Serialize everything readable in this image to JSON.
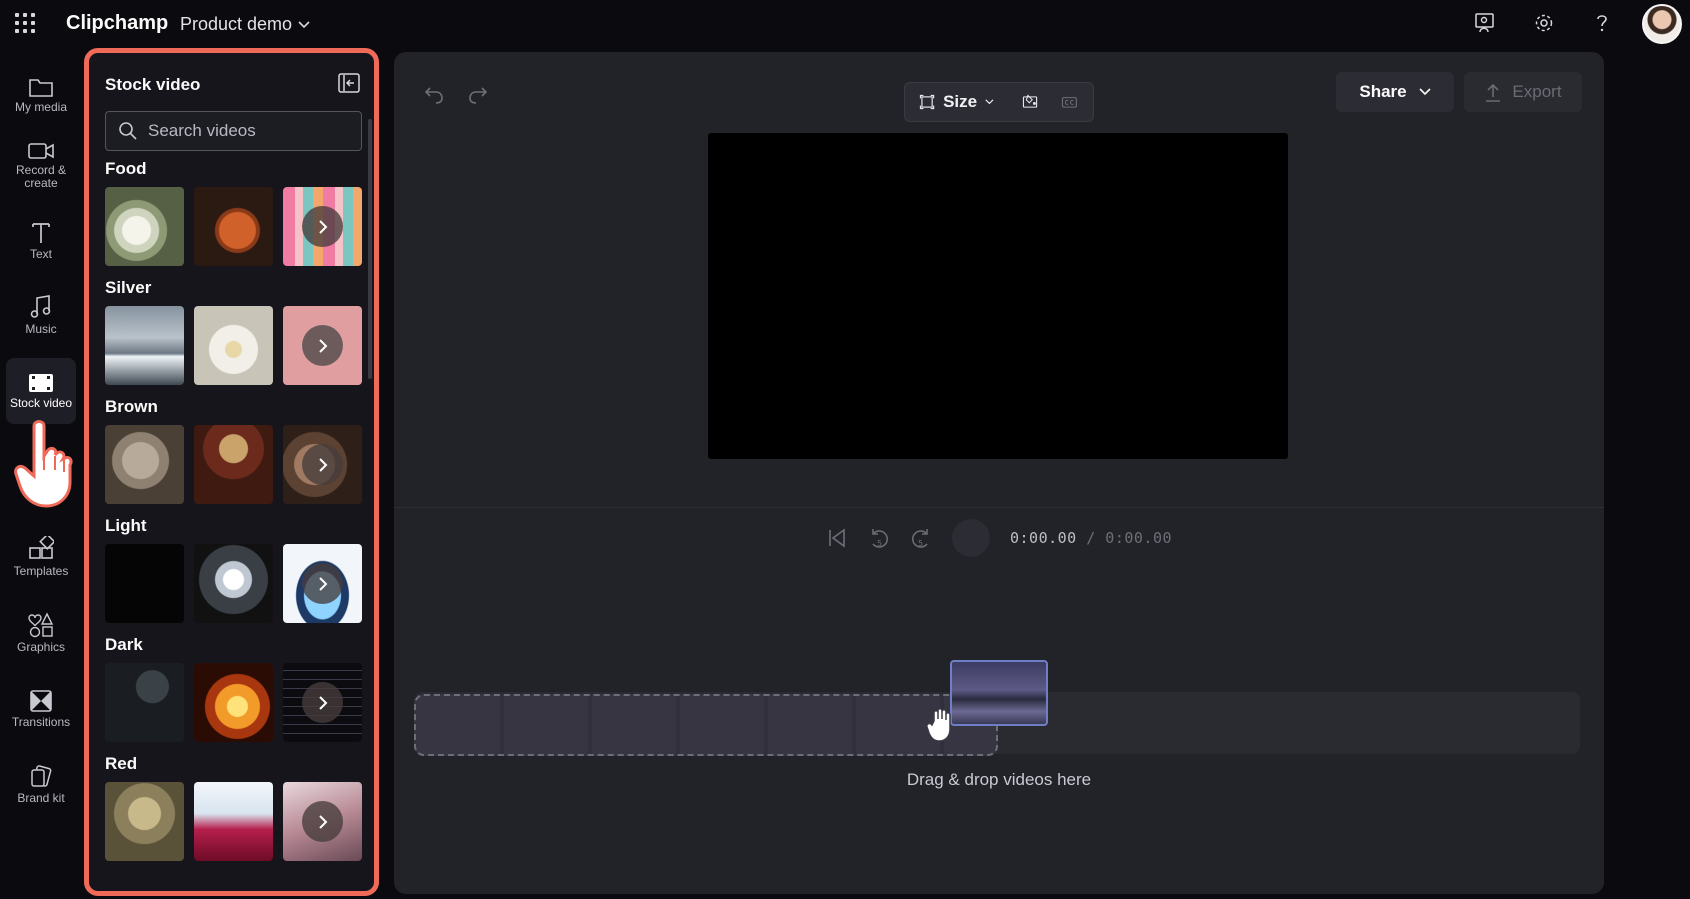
{
  "app": {
    "name": "Clipchamp",
    "project_name": "Product demo"
  },
  "rail": [
    {
      "label": "My media",
      "icon": "folder-icon"
    },
    {
      "label": "Record & create",
      "icon": "camera-icon"
    },
    {
      "label": "Text",
      "icon": "text-icon"
    },
    {
      "label": "Music",
      "icon": "music-note-icon"
    },
    {
      "label": "Stock video",
      "icon": "film-icon",
      "active": true
    },
    {
      "label": "Templates",
      "icon": "templates-icon"
    },
    {
      "label": "Graphics",
      "icon": "shapes-icon"
    },
    {
      "label": "Transitions",
      "icon": "transition-icon"
    },
    {
      "label": "Brand kit",
      "icon": "brand-kit-icon"
    }
  ],
  "panel": {
    "title": "Stock video",
    "search_placeholder": "Search videos",
    "categories": [
      {
        "title": "Food"
      },
      {
        "title": "Silver"
      },
      {
        "title": "Brown"
      },
      {
        "title": "Light"
      },
      {
        "title": "Dark"
      },
      {
        "title": "Red"
      }
    ]
  },
  "toolbar": {
    "size_label": "Size",
    "share_label": "Share",
    "export_label": "Export"
  },
  "playback": {
    "current_time": "0:00.00",
    "total_time": "/ 0:00.00"
  },
  "timeline": {
    "drop_hint": "Drag & drop videos here"
  },
  "colors": {
    "highlight": "#f06a5a",
    "background": "#0b0b0f",
    "panel": "#15151b",
    "main": "#222229"
  }
}
